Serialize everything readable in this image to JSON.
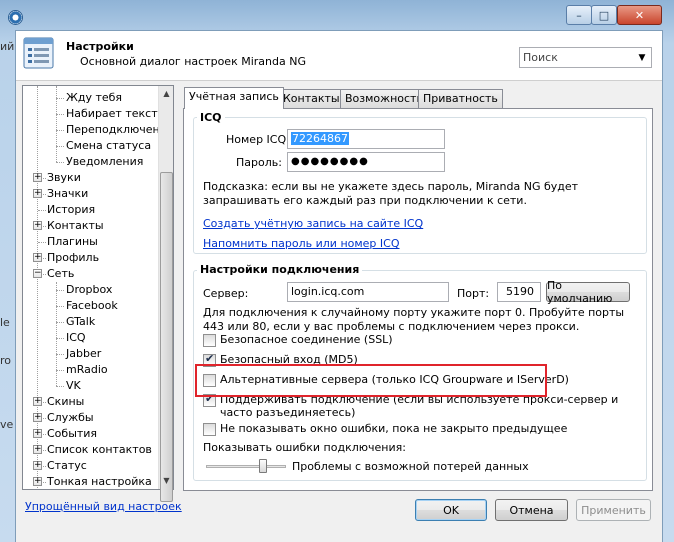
{
  "window": {
    "controls": {
      "minimize": "–",
      "maximize": "□",
      "close": "✕"
    }
  },
  "background_edge": [
    "ий",
    "",
    "",
    "",
    "",
    "",
    "",
    "",
    "",
    "",
    "le",
    "ro",
    "",
    "",
    "",
    "",
    "ve",
    "",
    "",
    "",
    "",
    ""
  ],
  "header": {
    "title": "Настройки",
    "subtitle": "Основной диалог настроек Miranda NG",
    "search_placeholder": "Поиск",
    "icon": "settings-list-icon"
  },
  "tree": {
    "items": [
      {
        "label": "Жду тебя",
        "level": 2
      },
      {
        "label": "Набирает текст",
        "level": 2
      },
      {
        "label": "Переподключени",
        "level": 2
      },
      {
        "label": "Смена статуса",
        "level": 2
      },
      {
        "label": "Уведомления",
        "level": 2
      },
      {
        "label": "Звуки",
        "level": 1,
        "expander": "+"
      },
      {
        "label": "Значки",
        "level": 1,
        "expander": "+"
      },
      {
        "label": "История",
        "level": 1
      },
      {
        "label": "Контакты",
        "level": 1,
        "expander": "+"
      },
      {
        "label": "Плагины",
        "level": 1
      },
      {
        "label": "Профиль",
        "level": 1,
        "expander": "+"
      },
      {
        "label": "Сеть",
        "level": 1,
        "expander": "−"
      },
      {
        "label": "Dropbox",
        "level": 2
      },
      {
        "label": "Facebook",
        "level": 2
      },
      {
        "label": "GTalk",
        "level": 2
      },
      {
        "label": "ICQ",
        "level": 2
      },
      {
        "label": "Jabber",
        "level": 2
      },
      {
        "label": "mRadio",
        "level": 2
      },
      {
        "label": "VK",
        "level": 2
      },
      {
        "label": "Скины",
        "level": 1,
        "expander": "+"
      },
      {
        "label": "Службы",
        "level": 1,
        "expander": "+"
      },
      {
        "label": "События",
        "level": 1,
        "expander": "+"
      },
      {
        "label": "Список контактов",
        "level": 1,
        "expander": "+"
      },
      {
        "label": "Статус",
        "level": 1,
        "expander": "+"
      },
      {
        "label": "Тонкая настройка",
        "level": 1,
        "expander": "+"
      }
    ]
  },
  "simple_view_link": "Упрощённый вид настроек",
  "tabs": [
    "Учётная запись",
    "Контакты",
    "Возможности",
    "Приватность"
  ],
  "icq_group": {
    "title": "ICQ",
    "uin_label": "Номер ICQ:",
    "uin_value": "72264867",
    "password_label": "Пароль:",
    "password_value": "●●●●●●●●",
    "hint": "Подсказка: если вы не укажете здесь пароль, Miranda NG будет запрашивать его каждый раз при подключении к сети.",
    "create_account_link": "Создать учётную запись на сайте ICQ",
    "remind_link": "Напомнить пароль или номер ICQ"
  },
  "connection_group": {
    "title": "Настройки подключения",
    "server_label": "Сервер:",
    "server_value": "login.icq.com",
    "port_label": "Порт:",
    "port_value": "5190",
    "default_button": "По умолчанию",
    "port_note": "Для подключения к случайному порту укажите порт 0. Пробуйте порты 443 или 80, если у вас проблемы с подключением через прокси.",
    "options": [
      {
        "label": "Безопасное соединение (SSL)",
        "checked": false
      },
      {
        "label": "Безопасный вход (MD5)",
        "checked": true
      },
      {
        "label": "Альтернативные сервера (только ICQ Groupware и IServerD)",
        "checked": false
      },
      {
        "label": "Поддерживать подключение (если вы используете прокси-сервер и часто разъединяетесь)",
        "checked": true
      },
      {
        "label": "Не показывать окно ошибки, пока не закрыто предыдущее",
        "checked": false
      }
    ],
    "errors_label": "Показывать ошибки подключения:",
    "errors_level_text": "Проблемы с возможной потерей данных",
    "errors_level": 0.7
  },
  "footer": {
    "ok": "OK",
    "cancel": "Отмена",
    "apply": "Применить"
  }
}
